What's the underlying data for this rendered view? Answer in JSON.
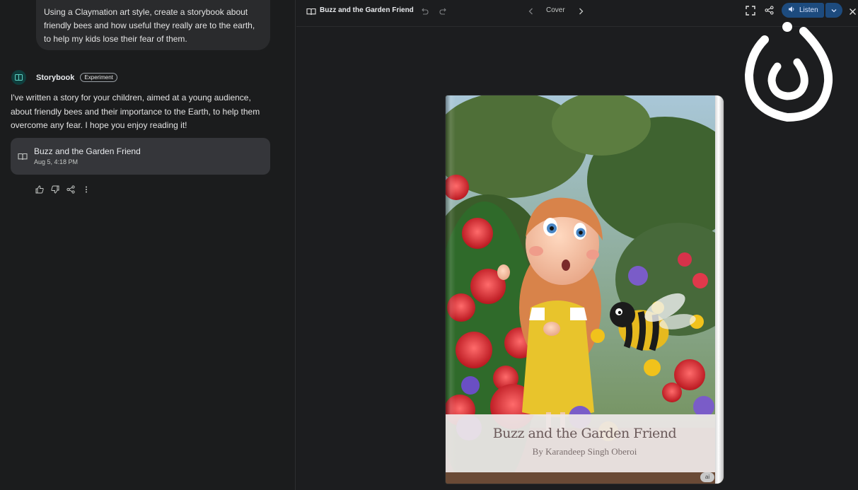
{
  "chat": {
    "prompt": "Using a Claymation art style, create a storybook about friendly bees and how useful they really are to the earth, to help my kids lose their fear of them.",
    "agent_name": "Storybook",
    "agent_badge": "Experiment",
    "response": "I've written a story for your children, aimed at a young audience, about friendly bees and their importance to the Earth, to help them overcome any fear. I hope you enjoy reading it!",
    "card": {
      "title": "Buzz and the Garden Friend",
      "date": "Aug 5, 4:18 PM"
    },
    "feedback_icons": [
      "thumbs-up-icon",
      "thumbs-down-icon",
      "share-icon",
      "more-vert-icon"
    ]
  },
  "viewer": {
    "title": "Buzz and the Garden Friend",
    "page_label": "Cover",
    "listen_label": "Listen",
    "icons": [
      "book-icon",
      "undo-icon",
      "redo-icon",
      "chevron-left-icon",
      "chevron-right-icon",
      "fullscreen-icon",
      "share-icon",
      "speaker-icon",
      "chevron-down-icon",
      "close-icon"
    ],
    "accent": "#1d4b7e"
  },
  "book": {
    "title": "Buzz and the Garden Friend",
    "author": "By Karandeep Singh Oberoi",
    "badge": "ai"
  }
}
